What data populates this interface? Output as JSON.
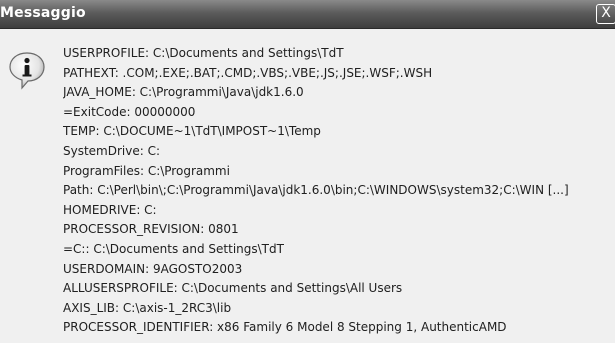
{
  "window": {
    "title": "Messaggio",
    "close_label": "X"
  },
  "icons": {
    "message_icon": "info-icon"
  },
  "message": {
    "lines": [
      "USERPROFILE: C:\\Documents and Settings\\TdT",
      "PATHEXT: .COM;.EXE;.BAT;.CMD;.VBS;.VBE;.JS;.JSE;.WSF;.WSH",
      "JAVA_HOME: C:\\Programmi\\Java\\jdk1.6.0",
      "=ExitCode: 00000000",
      "TEMP: C:\\DOCUME~1\\TdT\\IMPOST~1\\Temp",
      "SystemDrive: C:",
      "ProgramFiles: C:\\Programmi",
      "Path: C:\\Perl\\bin\\;C:\\Programmi\\Java\\jdk1.6.0\\bin;C:\\WINDOWS\\system32;C:\\WIN [...]",
      "HOMEDRIVE: C:",
      "PROCESSOR_REVISION: 0801",
      "=C:: C:\\Documents and Settings\\TdT",
      "USERDOMAIN: 9AGOSTO2003",
      "ALLUSERSPROFILE: C:\\Documents and Settings\\All Users",
      "AXIS_LIB: C:\\axis-1_2RC3\\lib",
      "PROCESSOR_IDENTIFIER: x86 Family 6 Model 8 Stepping 1, AuthenticAMD"
    ]
  }
}
